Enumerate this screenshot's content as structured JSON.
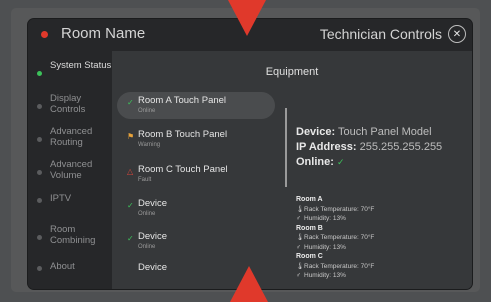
{
  "header": {
    "room_name": "Room Name",
    "title": "Technician Controls",
    "close_glyph": "✕"
  },
  "sidebar": {
    "items": [
      {
        "label": "System Status",
        "active": true
      },
      {
        "label": "Display Controls",
        "active": false
      },
      {
        "label": "Advanced Routing",
        "active": false
      },
      {
        "label": "Advanced Volume",
        "active": false
      },
      {
        "label": "IPTV",
        "active": false
      },
      {
        "label": "Room Combining",
        "active": false
      },
      {
        "label": "About",
        "active": false
      }
    ]
  },
  "main": {
    "title": "Equipment",
    "equipment": [
      {
        "name": "Room A Touch Panel",
        "status": "Online",
        "icon": "check-icon",
        "color": "#3cc15a"
      },
      {
        "name": "Room B Touch Panel",
        "status": "Warning",
        "icon": "flag-icon",
        "color": "#e8a33a"
      },
      {
        "name": "Room C Touch Panel",
        "status": "Fault",
        "icon": "warning-triangle-icon",
        "color": "#d9453a"
      },
      {
        "name": "Device",
        "status": "Online",
        "icon": "check-icon",
        "color": "#3cc15a"
      },
      {
        "name": "Device",
        "status": "Online",
        "icon": "check-icon",
        "color": "#3cc15a"
      },
      {
        "name": "Device",
        "status": "",
        "icon": "",
        "color": ""
      }
    ],
    "details": {
      "device_label": "Device:",
      "device_value": "Touch Panel Model",
      "ip_label": "IP Address:",
      "ip_value": "255.255.255.255",
      "online_label": "Online:",
      "online_glyph": "✓"
    },
    "rooms": [
      {
        "name": "Room A",
        "temp": "Rack Temperature: 70°F",
        "humidity": "Humidity: 13%"
      },
      {
        "name": "Room B",
        "temp": "Rack Temperature: 70°F",
        "humidity": "Humidity: 13%"
      },
      {
        "name": "Room C",
        "temp": "Rack Temperature: 70°F",
        "humidity": "Humidity: 13%"
      }
    ]
  },
  "colors": {
    "accent_red": "#e0392b",
    "status_green": "#3cc15a",
    "warning": "#e8a33a",
    "fault": "#d9453a"
  }
}
